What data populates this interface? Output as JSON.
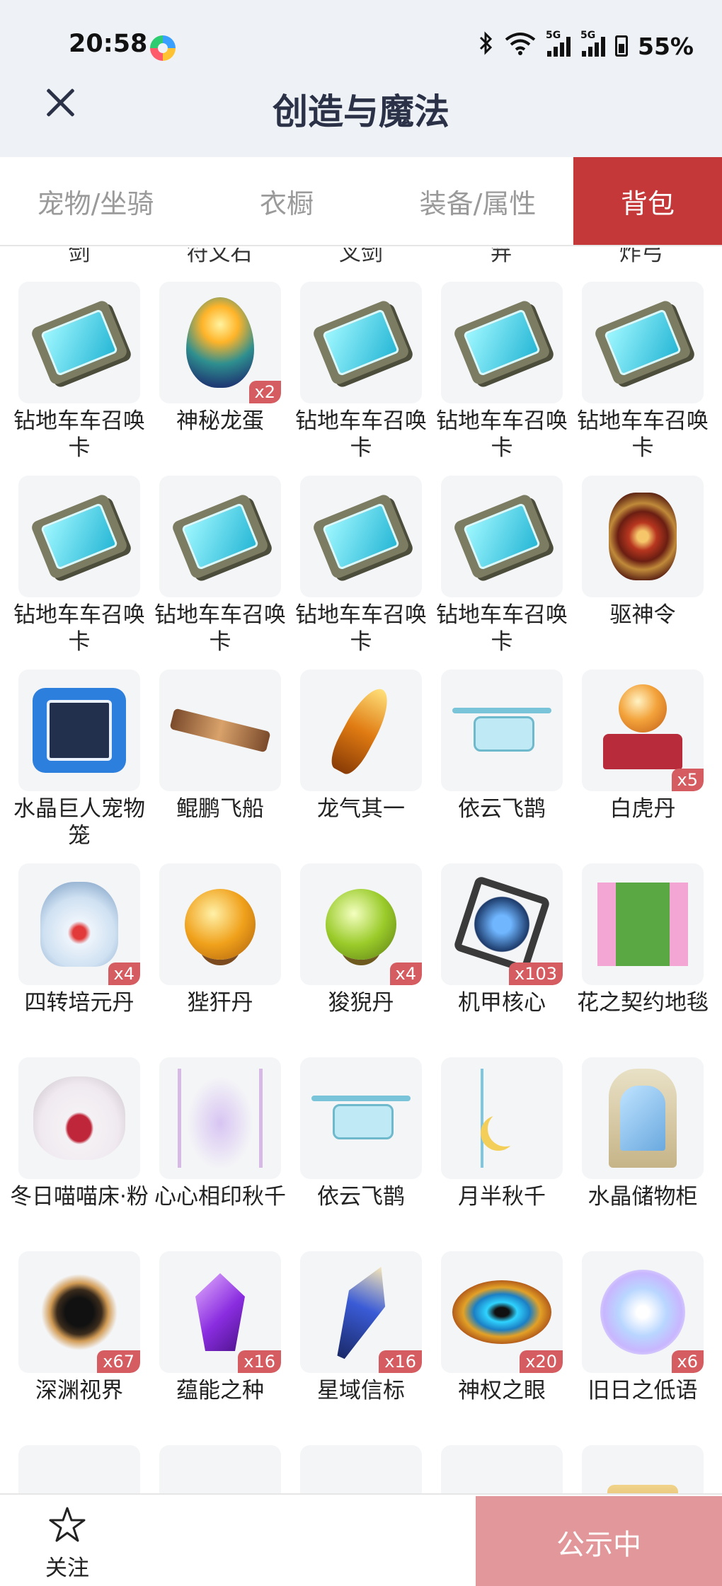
{
  "status_bar": {
    "time": "20:58",
    "network_a": "5G",
    "network_b": "5G",
    "battery": "55%"
  },
  "header": {
    "title": "创造与魔法"
  },
  "tabs": [
    {
      "label": "宠物/坐骑",
      "active": false
    },
    {
      "label": "衣橱",
      "active": false
    },
    {
      "label": "装备/属性",
      "active": false
    },
    {
      "label": "背包",
      "active": true
    }
  ],
  "cut_off_labels": [
    "剑",
    "符文石",
    "叉剑",
    "笄",
    "炸弓"
  ],
  "items": [
    {
      "name": "钻地车车召唤卡",
      "icon": "summon-card-icon"
    },
    {
      "name": "神秘龙蛋",
      "qty": "x2",
      "icon": "dragon-egg-icon"
    },
    {
      "name": "钻地车车召唤卡",
      "icon": "summon-card-icon"
    },
    {
      "name": "钻地车车召唤卡",
      "icon": "summon-card-icon"
    },
    {
      "name": "钻地车车召唤卡",
      "icon": "summon-card-icon"
    },
    {
      "name": "钻地车车召唤卡",
      "icon": "summon-card-icon"
    },
    {
      "name": "钻地车车召唤卡",
      "icon": "summon-card-icon"
    },
    {
      "name": "钻地车车召唤卡",
      "icon": "summon-card-icon"
    },
    {
      "name": "钻地车车召唤卡",
      "icon": "summon-card-icon"
    },
    {
      "name": "驱神令",
      "icon": "amulet-icon"
    },
    {
      "name": "水晶巨人宠物笼",
      "icon": "pet-cage-icon"
    },
    {
      "name": "鲲鹏飞船",
      "icon": "airship-icon"
    },
    {
      "name": "龙气其一",
      "icon": "dragon-feather-icon"
    },
    {
      "name": "依云飞鹊",
      "icon": "drone-icon"
    },
    {
      "name": "白虎丹",
      "qty": "x5",
      "icon": "pedestal-orb-icon"
    },
    {
      "name": "四转培元丹",
      "qty": "x4",
      "icon": "potion-flask-icon"
    },
    {
      "name": "狴犴丹",
      "icon": "gold-orb-icon"
    },
    {
      "name": "狻猊丹",
      "qty": "x4",
      "icon": "green-orb-icon"
    },
    {
      "name": "机甲核心",
      "qty": "x103",
      "icon": "mech-core-icon"
    },
    {
      "name": "花之契约地毯",
      "icon": "flower-carpet-icon"
    },
    {
      "name": "冬日喵喵床·粉",
      "icon": "cat-bed-icon"
    },
    {
      "name": "心心相印秋千",
      "icon": "heart-swing-icon"
    },
    {
      "name": "依云飞鹊",
      "icon": "drone-icon"
    },
    {
      "name": "月半秋千",
      "icon": "moon-swing-icon"
    },
    {
      "name": "水晶储物柜",
      "icon": "crystal-cabinet-icon"
    },
    {
      "name": "深渊视界",
      "qty": "x67",
      "icon": "abyss-icon"
    },
    {
      "name": "蕴能之种",
      "qty": "x16",
      "icon": "crystal-seed-icon"
    },
    {
      "name": "星域信标",
      "qty": "x16",
      "icon": "star-beacon-icon"
    },
    {
      "name": "神权之眼",
      "qty": "x20",
      "icon": "divine-eye-icon"
    },
    {
      "name": "旧日之低语",
      "qty": "x6",
      "icon": "glow-orb-icon"
    },
    {
      "name": "",
      "icon": "gold-horn-icon"
    },
    {
      "name": "",
      "icon": "white-horn-icon"
    },
    {
      "name": "",
      "icon": "ticket-icon"
    },
    {
      "name": "",
      "icon": "ticket-icon"
    },
    {
      "name": "",
      "icon": "scroll-icon"
    }
  ],
  "bottom_bar": {
    "follow_label": "关注",
    "status_button": "公示中"
  },
  "colors": {
    "active_tab": "#c4383a",
    "qty_badge": "#d55c60",
    "status_button": "#e2979a",
    "title": "#2b3248"
  }
}
